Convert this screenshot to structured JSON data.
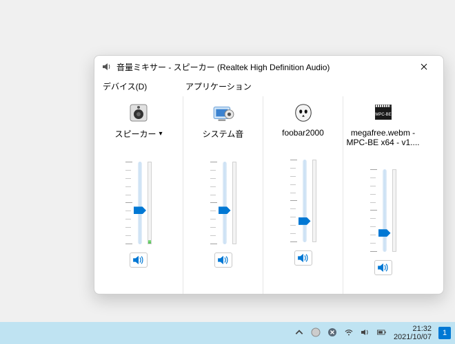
{
  "window": {
    "title": "音量ミキサー - スピーカー (Realtek High Definition Audio)"
  },
  "sections": {
    "device": "デバイス(D)",
    "applications": "アプリケーション"
  },
  "device_channel": {
    "name": "スピーカー",
    "volume_percent": 40,
    "meter_percent": 4
  },
  "app_channels": [
    {
      "name": "システム音",
      "volume_percent": 40,
      "meter_percent": 0
    },
    {
      "name": "foobar2000",
      "volume_percent": 23,
      "meter_percent": 0
    },
    {
      "name": "megafree.webm - MPC-BE x64 - v1....",
      "volume_percent": 20,
      "meter_percent": 0
    }
  ],
  "taskbar": {
    "time": "21:32",
    "date": "2021/10/07",
    "notifications": "1"
  }
}
